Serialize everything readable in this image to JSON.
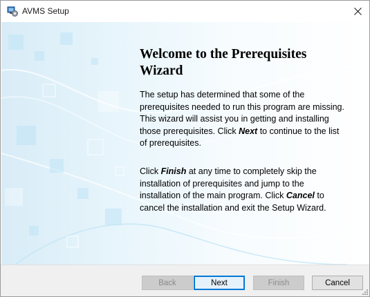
{
  "window": {
    "title": "AVMS Setup"
  },
  "wizard": {
    "heading": "Welcome to the Prerequisites Wizard",
    "para1": {
      "before": "The setup has determined that some of the prerequisites needed to run this program are missing. This wizard will assist you in getting and installing those prerequisites. Click ",
      "emphasis": "Next",
      "after": "  to continue to the list of prerequisites."
    },
    "para2": {
      "t1": "Click ",
      "e1": "Finish",
      "t2": " at any time to completely skip the installation of prerequisites and jump to the installation of the main program. Click ",
      "e2": "Cancel",
      "t3": " to cancel the installation and exit the Setup Wizard."
    }
  },
  "buttons": {
    "back": "Back",
    "next": "Next",
    "finish": "Finish",
    "cancel": "Cancel"
  },
  "icons": {
    "app": "setup-installer-icon",
    "close": "close-icon",
    "grip": "resize-grip-icon"
  },
  "colors": {
    "accent": "#0078d7",
    "footer": "#f0f0f0",
    "art": "#bfe3f5"
  }
}
